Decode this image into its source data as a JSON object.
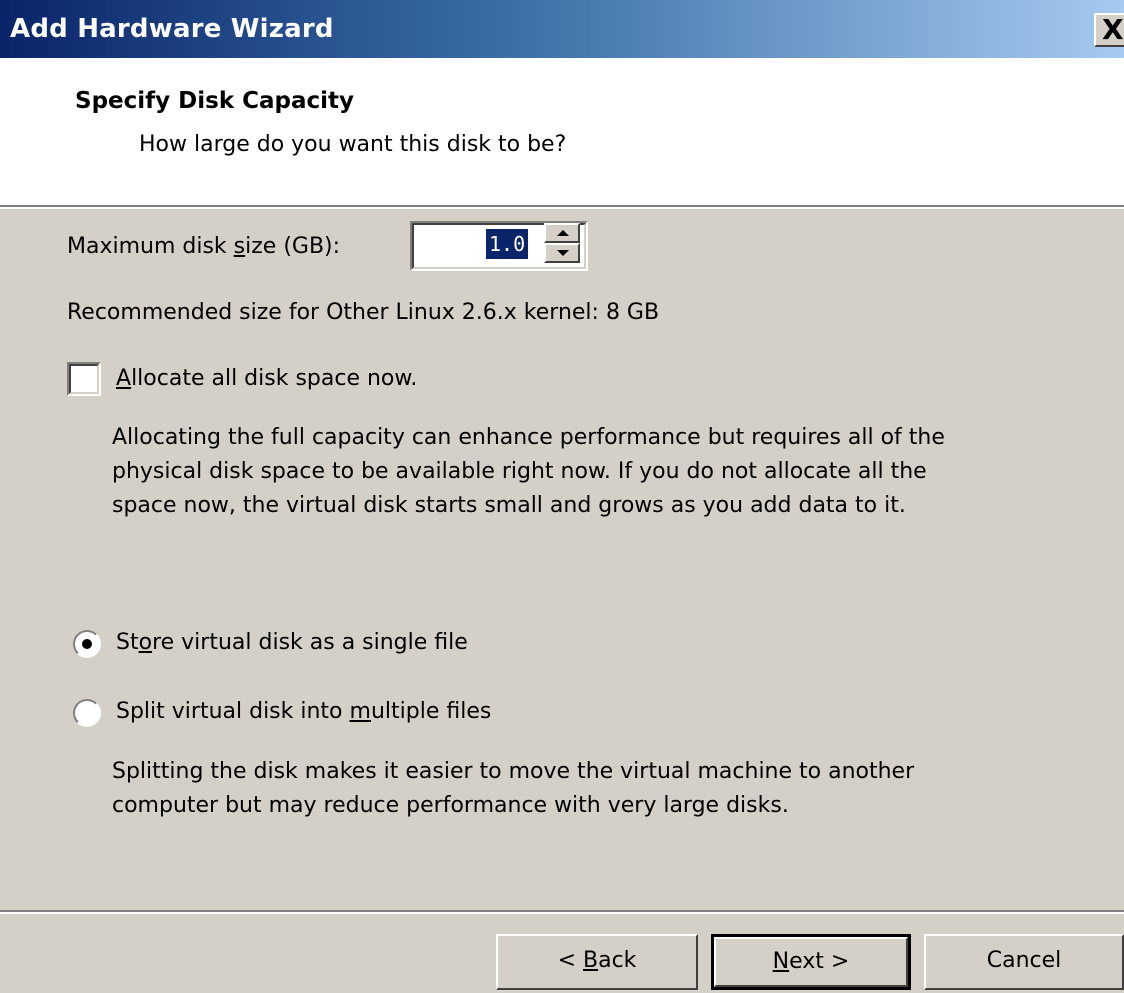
{
  "window": {
    "title": "Add Hardware Wizard",
    "close_glyph": "X"
  },
  "header": {
    "title": "Specify Disk Capacity",
    "subtitle": "How large do you want this disk to be?"
  },
  "disk_size": {
    "label_pre": "Maximum disk ",
    "label_mnemonic": "s",
    "label_post": "ize (GB):",
    "value": "1.0"
  },
  "recommendation": "Recommended size for Other Linux 2.6.x kernel: 8 GB",
  "allocate": {
    "checked": false,
    "label_mnemonic": "A",
    "label_rest": "llocate all disk space now.",
    "description": [
      "Allocating the full capacity can enhance performance but requires all of the",
      "physical disk space to be available right now. If you do not allocate all the",
      "space now, the virtual disk starts small and grows as you add data to it."
    ]
  },
  "storage": {
    "single_file": {
      "selected": true,
      "label_pre": "St",
      "label_mnemonic": "o",
      "label_post": "re virtual disk as a single file"
    },
    "split_files": {
      "selected": false,
      "label_pre": "Split virtual disk into ",
      "label_mnemonic": "m",
      "label_post": "ultiple files",
      "description": [
        "Splitting the disk makes it easier to move the virtual machine to another",
        "computer but may reduce performance with very large disks."
      ]
    }
  },
  "buttons": {
    "back_pre": "< ",
    "back_mnemonic": "B",
    "back_post": "ack",
    "next_mnemonic": "N",
    "next_post": "ext >",
    "cancel": "Cancel"
  }
}
